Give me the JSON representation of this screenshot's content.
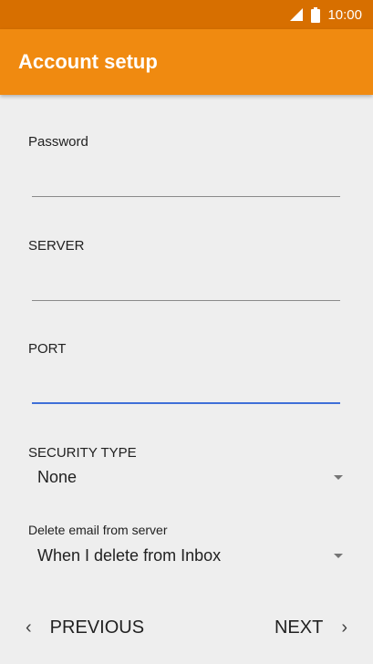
{
  "status_bar": {
    "time": "10:00",
    "icons": [
      "cell-signal-icon",
      "battery-icon"
    ]
  },
  "app_bar": {
    "title": "Account setup"
  },
  "form": {
    "password": {
      "label": "Password",
      "value": ""
    },
    "server": {
      "label": "SERVER",
      "value": ""
    },
    "port": {
      "label": "PORT",
      "value": ""
    },
    "security_type": {
      "label": "SECURITY TYPE",
      "selected": "None"
    },
    "delete_email": {
      "label": "Delete email from server",
      "selected": "When I delete from Inbox"
    }
  },
  "bottom_bar": {
    "previous_label": "PREVIOUS",
    "next_label": "NEXT"
  },
  "colors": {
    "status_bar": "#d76f00",
    "app_bar": "#f08a10",
    "focus_line": "#3f6fd8",
    "background": "#eeeeee"
  }
}
